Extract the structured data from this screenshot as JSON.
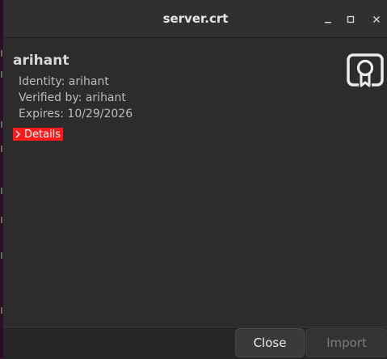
{
  "window": {
    "title": "server.crt",
    "controls": {
      "minimize_icon": "minimize-icon",
      "maximize_icon": "maximize-icon",
      "close_icon": "close-icon"
    }
  },
  "certificate": {
    "name": "arihant",
    "identity": "Identity: arihant",
    "verified_by": "Verified by: arihant",
    "expires": "Expires: 10/29/2026",
    "details_label": "Details",
    "icon": "certificate-icon"
  },
  "footer": {
    "close_label": "Close",
    "import_label": "Import"
  },
  "colors": {
    "details_highlight": "#ff1a1a",
    "window_bg": "#2c2c2c"
  }
}
